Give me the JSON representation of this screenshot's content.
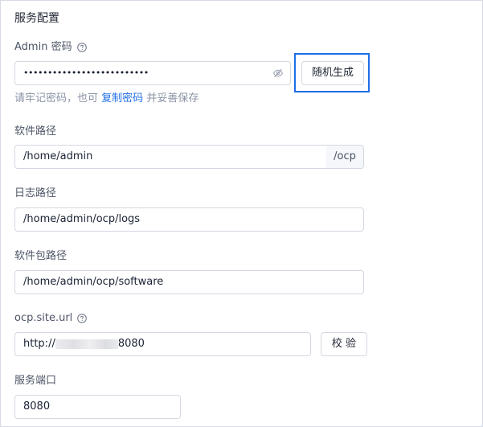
{
  "section": {
    "title": "服务配置"
  },
  "admin_password": {
    "label": "Admin 密码",
    "value_masked": "••••••••••••••••••••••••••",
    "generate_button": "随机生成",
    "hint_prefix": "请牢记密码，也可",
    "hint_link": "复制密码",
    "hint_suffix": "并妥善保存"
  },
  "software_path": {
    "label": "软件路径",
    "value": "/home/admin",
    "suffix": "/ocp"
  },
  "log_path": {
    "label": "日志路径",
    "value": "/home/admin/ocp/logs"
  },
  "package_path": {
    "label": "软件包路径",
    "value": "/home/admin/ocp/software"
  },
  "site_url": {
    "label": "ocp.site.url",
    "value_prefix": "http://",
    "value_suffix": "8080",
    "verify_button": "校 验"
  },
  "service_port": {
    "label": "服务端口",
    "value": "8080"
  },
  "icons": {
    "help": "question-circle-icon",
    "eye": "eye-invisible-icon"
  },
  "colors": {
    "accent": "#1e6fe6",
    "border": "#d3d8e0",
    "hint": "#8a93a5"
  }
}
